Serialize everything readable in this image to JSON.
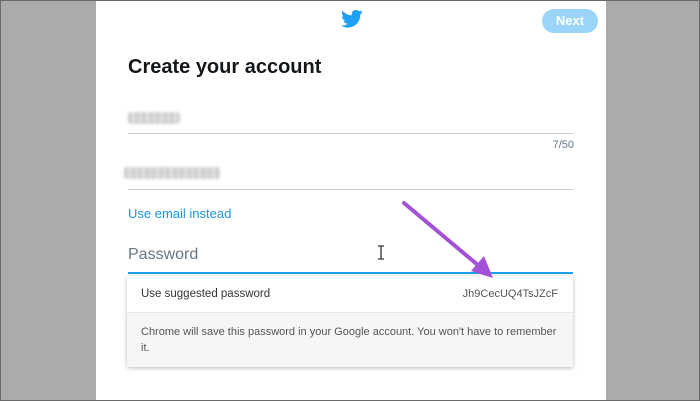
{
  "header": {
    "logo_icon": "twitter-bird-icon",
    "next_label": "Next",
    "brand_color": "#1da1f2",
    "next_button_color": "#9ad4f9"
  },
  "form": {
    "title": "Create your account",
    "name_counter": "7/50",
    "use_email_label": "Use email instead",
    "password_placeholder": "Password"
  },
  "autofill": {
    "suggest_label": "Use suggested password",
    "suggested_password": "Jh9CecUQ4TsJZcF",
    "note": "Chrome will save this password in your Google account. You won't have to remember it."
  },
  "annotation": {
    "arrow_color": "#a352d8"
  }
}
